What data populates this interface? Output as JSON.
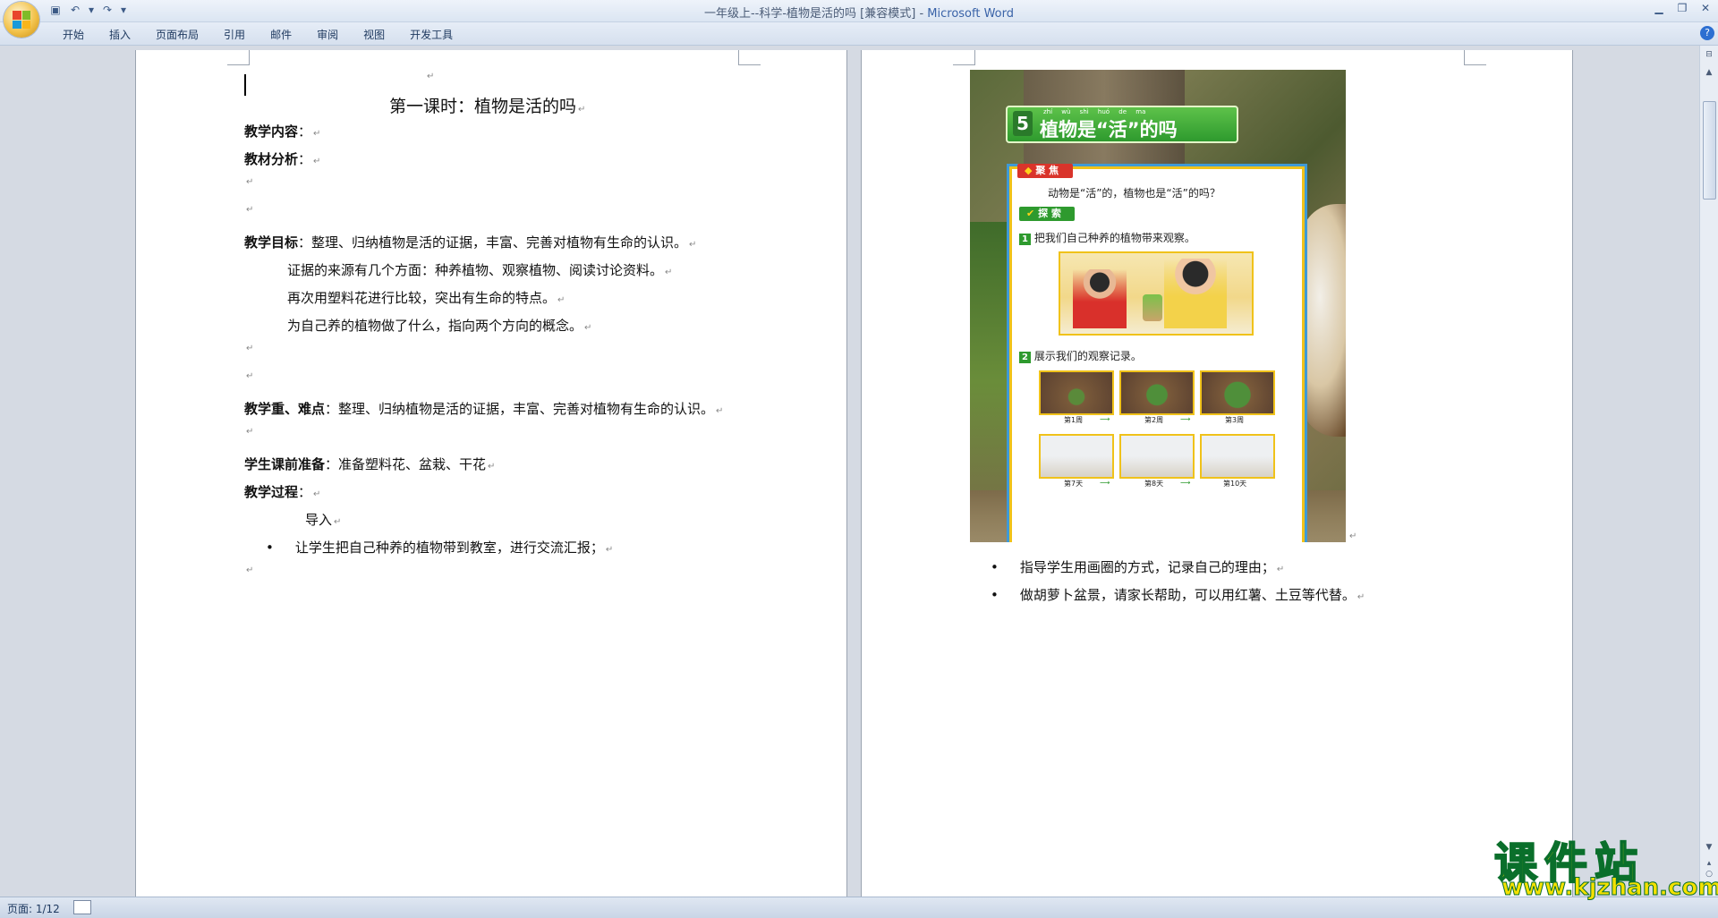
{
  "window": {
    "title": "一年级上--科学-植物是活的吗 [兼容模式]",
    "app_name": "Microsoft Word",
    "separator": " - "
  },
  "ribbon": {
    "tabs": [
      "开始",
      "插入",
      "页面布局",
      "引用",
      "邮件",
      "审阅",
      "视图",
      "开发工具"
    ]
  },
  "left_page": {
    "heading": "第一课时：植物是活的吗",
    "lines": [
      {
        "bold": "教学内容",
        "text": "："
      },
      {
        "bold": "教材分析",
        "text": "："
      },
      {
        "bold": "教学目标",
        "text": "：整理、归纳植物是活的证据，丰富、完善对植物有生命的认识。"
      },
      {
        "text": "证据的来源有几个方面：种养植物、观察植物、阅读讨论资料。"
      },
      {
        "text": "再次用塑料花进行比较，突出有生命的特点。"
      },
      {
        "text": "为自己养的植物做了什么，指向两个方向的概念。"
      },
      {
        "bold": "教学重、难点",
        "text": "：整理、归纳植物是活的证据，丰富、完善对植物有生命的认识。"
      },
      {
        "bold": "学生课前准备",
        "text": "：准备塑料花、盆栽、干花"
      },
      {
        "bold": "教学过程",
        "text": "："
      },
      {
        "text": "导入"
      },
      {
        "text": "让学生把自己种养的植物带到教室，进行交流汇报；"
      }
    ]
  },
  "right_page": {
    "textbook": {
      "lesson_number": "5",
      "title": "植物是“活”的吗",
      "pinyin": "zhí wù shì huó de ma",
      "focus_label": "聚 焦",
      "focus_question": "动物是“活”的，植物也是“活”的吗？",
      "explore_label": "探 索",
      "step1_num": "1",
      "step1_text": "把我们自己种养的植物带来观察。",
      "step2_num": "2",
      "step2_text": "展示我们的观察记录。",
      "row1_labels": [
        "第1周",
        "第2周",
        "第3周"
      ],
      "row2_labels": [
        "第7天",
        "第8天",
        "第10天"
      ]
    },
    "bullets": [
      "指导学生用画圈的方式，记录自己的理由；",
      "做胡萝卜盆景，请家长帮助，可以用红薯、土豆等代替。"
    ]
  },
  "status": {
    "page": "页面: 1/12"
  },
  "watermark": {
    "cn": "课件站",
    "url": "www.kjzhan.com"
  },
  "colors": {
    "green": "#3aa43a",
    "book_frame": "#f0c21a",
    "book_border": "#3f9ad6"
  }
}
